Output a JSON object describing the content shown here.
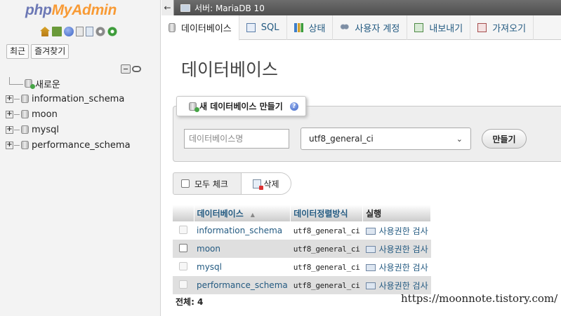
{
  "nav": {
    "logo": {
      "php": "php",
      "my": "My",
      "admin": "Admin"
    },
    "icons": [
      "home-icon",
      "logout-icon",
      "help-icon",
      "docs-icon",
      "sql-docs-icon",
      "settings-gear-icon",
      "reload-icon"
    ],
    "tabs": [
      "최근",
      "즐겨찾기"
    ],
    "tree": [
      {
        "label": "새로운",
        "icon": "new-database-icon"
      },
      {
        "label": "information_schema",
        "icon": "database-icon"
      },
      {
        "label": "moon",
        "icon": "database-icon"
      },
      {
        "label": "mysql",
        "icon": "database-icon"
      },
      {
        "label": "performance_schema",
        "icon": "database-icon"
      }
    ],
    "expander_symbol": "+"
  },
  "topbar": {
    "collapse_symbol": "←",
    "server_label": "서버: MariaDB 10"
  },
  "tabs": [
    {
      "label": "데이터베이스",
      "active": true,
      "icon": "database-icon"
    },
    {
      "label": "SQL",
      "active": false,
      "icon": "sql-icon"
    },
    {
      "label": "상태",
      "active": false,
      "icon": "status-icon"
    },
    {
      "label": "사용자 계정",
      "active": false,
      "icon": "user-accounts-icon"
    },
    {
      "label": "내보내기",
      "active": false,
      "icon": "export-icon"
    },
    {
      "label": "가져오기",
      "active": false,
      "icon": "import-icon"
    }
  ],
  "main": {
    "title": "데이터베이스",
    "create": {
      "legend": "새 데이터베이스 만들기",
      "name_placeholder": "데이터베이스명",
      "collation": "utf8_general_ci",
      "button": "만들기"
    },
    "bulk": {
      "check_all": "모두 체크",
      "drop": "삭제"
    },
    "table": {
      "headers": {
        "database": "데이터베이스",
        "collation": "데이터정렬방식",
        "action": "실행"
      },
      "sort_symbol": "▲",
      "rows": [
        {
          "name": "information_schema",
          "collation": "utf8_general_ci",
          "action": "사용권한 검사",
          "checkbox_disabled": true
        },
        {
          "name": "moon",
          "collation": "utf8_general_ci",
          "action": "사용권한 검사",
          "checkbox_disabled": false
        },
        {
          "name": "mysql",
          "collation": "utf8_general_ci",
          "action": "사용권한 검사",
          "checkbox_disabled": true
        },
        {
          "name": "performance_schema",
          "collation": "utf8_general_ci",
          "action": "사용권한 검사",
          "checkbox_disabled": true
        }
      ]
    },
    "total": "전체: 4"
  },
  "watermark": "https://moonnote.tistory.com/",
  "colors": {
    "link": "#235a81",
    "topbar": "#5a5a5a",
    "logo_php": "#6c78b5",
    "logo_myadmin": "#f89a34"
  }
}
